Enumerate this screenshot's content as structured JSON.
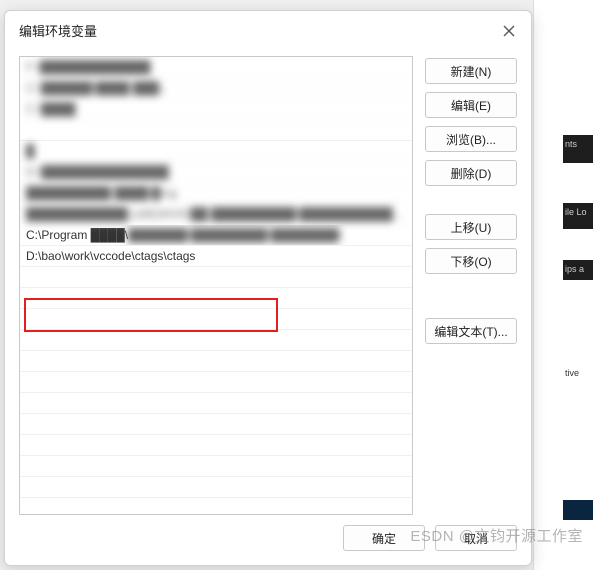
{
  "dialog": {
    "title": "编辑环境变量"
  },
  "list": {
    "items": [
      {
        "text": "F:\\█████████████",
        "blur": true
      },
      {
        "text": "C:\\██████\\████ ███L",
        "blur": true
      },
      {
        "text": "C:\\████",
        "blur": true
      },
      {
        "text": "",
        "blur": false
      },
      {
        "text": "█",
        "blur": true
      },
      {
        "text": "D:\\███████████████",
        "blur": true
      },
      {
        "text": "██████████ ████\\█mg",
        "blur": true
      },
      {
        "text_prefix": "████████████ (x86)\\NVID██ ██████████\\██████████████████n",
        "blur": true
      },
      {
        "text_prefix": "C:\\Program ████\\",
        "text_suffix_blur": "███████\\█████████\\████████\\",
        "partial": true
      },
      {
        "text": "D:\\bao\\work\\vccode\\ctags\\ctags",
        "blur": false,
        "highlighted": true
      },
      {
        "text": "",
        "blur": false
      },
      {
        "text": "",
        "blur": false
      },
      {
        "text": "",
        "blur": false
      },
      {
        "text": "",
        "blur": false
      },
      {
        "text": "",
        "blur": false
      },
      {
        "text": "",
        "blur": false
      },
      {
        "text": "",
        "blur": false
      },
      {
        "text": "",
        "blur": false
      },
      {
        "text": "",
        "blur": false
      },
      {
        "text": "",
        "blur": false
      },
      {
        "text": "",
        "blur": false
      }
    ]
  },
  "buttons": {
    "new": "新建(N)",
    "edit": "编辑(E)",
    "browse": "浏览(B)...",
    "delete": "删除(D)",
    "moveup": "上移(U)",
    "movedown": "下移(O)",
    "edittext": "编辑文本(T)...",
    "ok": "确定",
    "cancel": "取消"
  },
  "backdrop": {
    "snip1": "nts",
    "snip2": "ile Lo",
    "snip3": "ips a",
    "snip4": "tive"
  },
  "watermark": "ESDN @文钧开源工作室"
}
